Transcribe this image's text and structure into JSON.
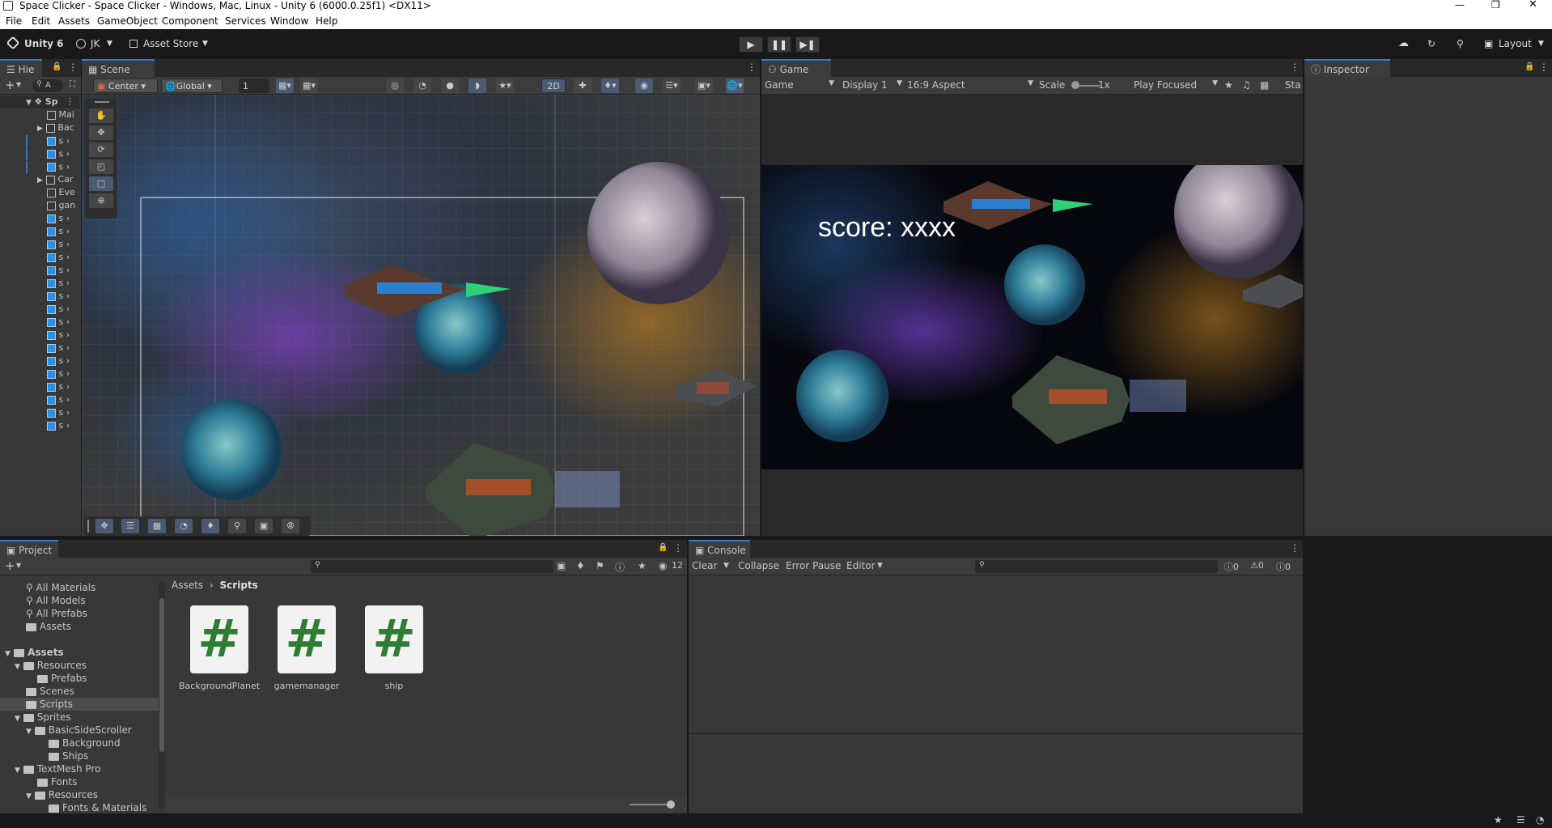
{
  "window": {
    "title": "Space Clicker - Space Clicker - Windows, Mac, Linux - Unity 6 (6000.0.25f1) <DX11>"
  },
  "menu": [
    "File",
    "Edit",
    "Assets",
    "GameObject",
    "Component",
    "Services",
    "Window",
    "Help"
  ],
  "toolbar": {
    "unity_label": "Unity 6",
    "account": "JK",
    "asset_store": "Asset Store",
    "layout": "Layout"
  },
  "hierarchy": {
    "tab": "Hie",
    "search_placeholder": "A",
    "rows": [
      "Sp",
      "Mai",
      "Bac",
      "s",
      "s",
      "s",
      "Car",
      "Eve",
      "gan",
      "s",
      "s",
      "s",
      "s",
      "s",
      "s",
      "s",
      "s",
      "s",
      "s",
      "s",
      "s",
      "s",
      "s",
      "s",
      "s",
      "s"
    ]
  },
  "scene": {
    "tab": "Scene",
    "pivot": "Center",
    "space": "Global",
    "snap": "1",
    "mode_2d": "2D"
  },
  "game": {
    "tab": "Game",
    "view": "Game",
    "display": "Display 1",
    "aspect": "16:9 Aspect",
    "scale_label": "Scale",
    "scale_value": "1x",
    "play_mode": "Play Focused",
    "stats": "Sta",
    "score_text": "score: xxxx"
  },
  "inspector": {
    "tab": "Inspector"
  },
  "project": {
    "tab": "Project",
    "hidden_count": "12",
    "favorites": [
      "All Materials",
      "All Models",
      "All Prefabs",
      "Assets"
    ],
    "tree": [
      {
        "label": "Assets",
        "indent": 0,
        "bold": true
      },
      {
        "label": "Resources",
        "indent": 1
      },
      {
        "label": "Prefabs",
        "indent": 2
      },
      {
        "label": "Scenes",
        "indent": 1
      },
      {
        "label": "Scripts",
        "indent": 1,
        "selected": true
      },
      {
        "label": "Sprites",
        "indent": 1
      },
      {
        "label": "BasicSideScroller",
        "indent": 2
      },
      {
        "label": "Background",
        "indent": 3
      },
      {
        "label": "Ships",
        "indent": 3
      },
      {
        "label": "TextMesh Pro",
        "indent": 1
      },
      {
        "label": "Fonts",
        "indent": 2
      },
      {
        "label": "Resources",
        "indent": 2
      },
      {
        "label": "Fonts & Materials",
        "indent": 3
      }
    ],
    "breadcrumb": [
      "Assets",
      "Scripts"
    ],
    "files": [
      "BackgroundPlanet",
      "gamemanager",
      "ship"
    ]
  },
  "console": {
    "tab": "Console",
    "clear": "Clear",
    "collapse": "Collapse",
    "error_pause": "Error Pause",
    "editor": "Editor",
    "count_log": "0",
    "count_warn": "0",
    "count_err": "0"
  },
  "colors": {
    "accent": "#3a79bb",
    "panel": "#383838",
    "dark": "#191919"
  }
}
